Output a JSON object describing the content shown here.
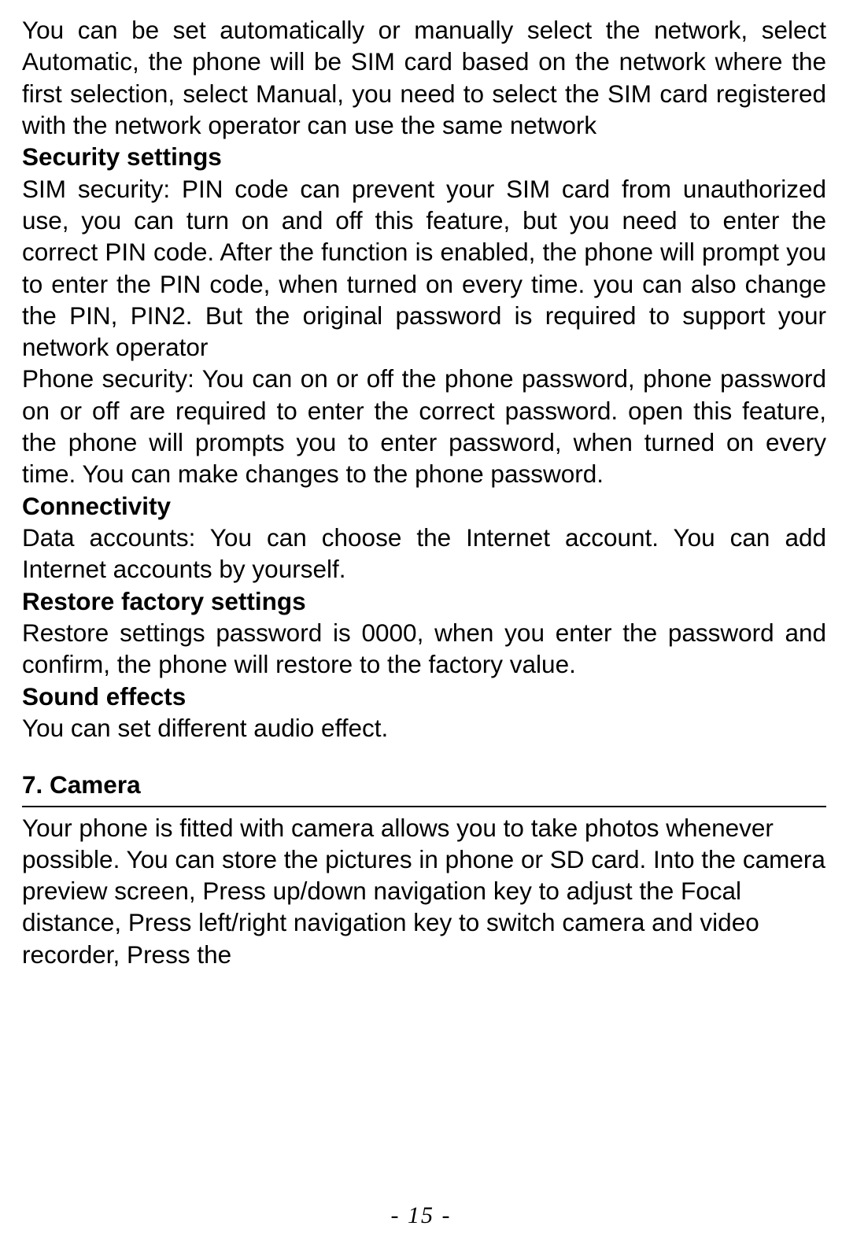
{
  "content": {
    "para1": "You can be set automatically or manually select the network, select Automatic, the phone will be SIM card based on the network where the first selection, select Manual, you need to select the SIM card registered with the network operator can use the same network",
    "heading_security": "Security settings",
    "para2": "SIM security: PIN code can prevent your SIM card from unauthorized use, you can turn on and off this feature, but you need to enter the correct PIN code. After the function is enabled, the phone will prompt you to enter the PIN code, when turned on every time. you can also change the PIN, PIN2. But the original password is required to support your network operator",
    "para3": "Phone security: You can on or off the phone password, phone password on or off are required to enter the correct password. open this feature, the phone will prompts you to enter password, when turned on every time. You can make changes to the phone password.",
    "heading_connectivity": "Connectivity",
    "para4": "Data accounts: You can choose the Internet account. You can add Internet accounts by yourself.",
    "heading_restore": "Restore factory settings",
    "para5": "Restore settings password is 0000, when you enter the password and confirm, the phone will restore to the factory value.",
    "heading_sound": "Sound effects",
    "para6": "You can set different audio effect.",
    "section_camera": "7. Camera",
    "para_camera": "Your phone is fitted with camera allows you to take photos whenever possible. You can store the pictures in phone or SD card. Into the camera preview screen, Press up/down navigation key to adjust the Focal distance, Press left/right navigation key to switch camera and video recorder, Press the"
  },
  "page_number": "- 15 -"
}
